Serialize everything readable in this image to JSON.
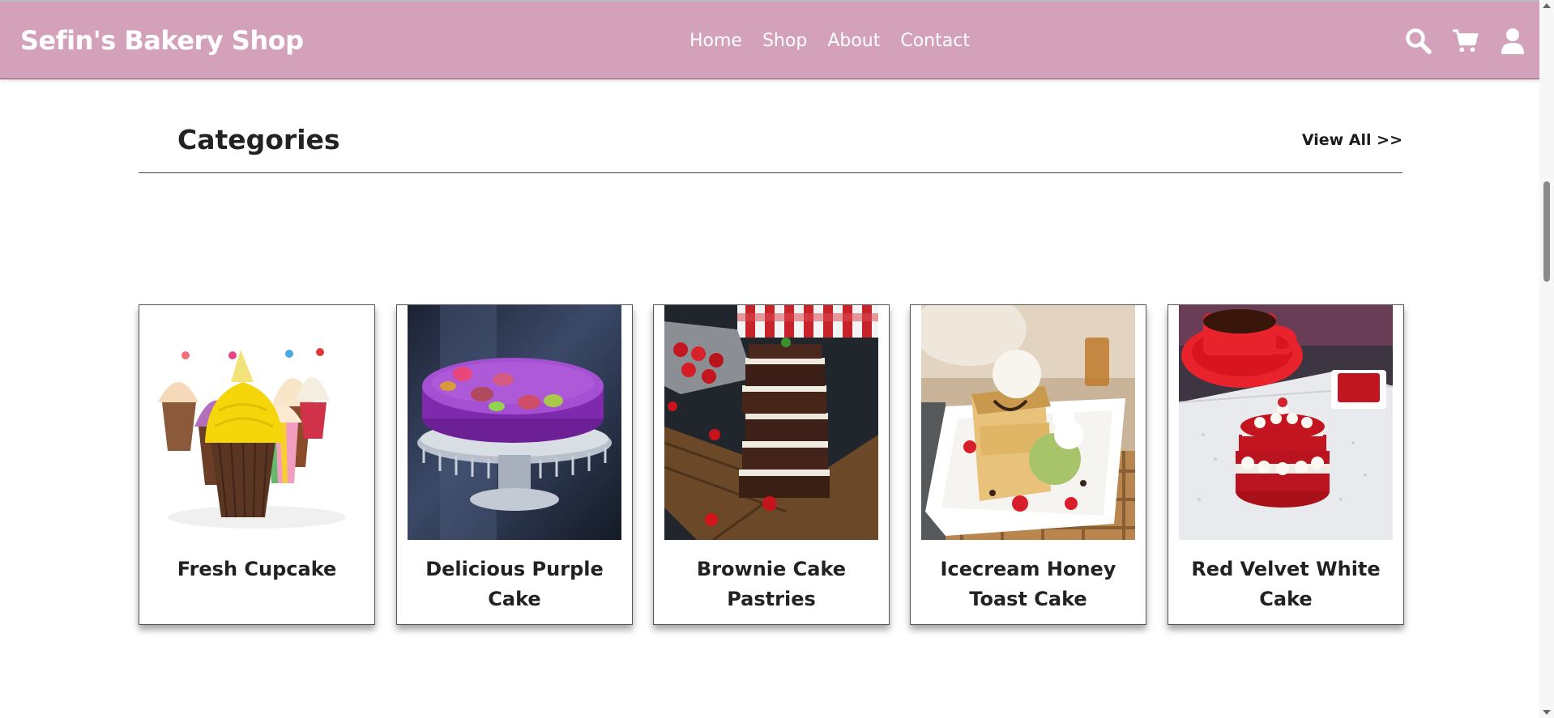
{
  "header": {
    "brand": "Sefin's Bakery Shop",
    "nav": [
      {
        "label": "Home"
      },
      {
        "label": "Shop"
      },
      {
        "label": "About"
      },
      {
        "label": "Contact"
      }
    ],
    "icons": [
      "search-icon",
      "cart-icon",
      "user-icon"
    ]
  },
  "categories": {
    "title": "Categories",
    "view_all": "View All >>",
    "items": [
      {
        "name": "Fresh Cupcake",
        "image": "cupcakes-image"
      },
      {
        "name": "Delicious Purple Cake",
        "image": "purple-cake-image"
      },
      {
        "name": "Brownie Cake Pastries",
        "image": "brownie-image"
      },
      {
        "name": "Icecream Honey Toast Cake",
        "image": "honey-toast-image"
      },
      {
        "name": "Red Velvet White Cake",
        "image": "red-velvet-image"
      }
    ]
  },
  "colors": {
    "header_bg": "#d4a1ba",
    "header_text": "#ffffff",
    "text_dark": "#222222"
  }
}
